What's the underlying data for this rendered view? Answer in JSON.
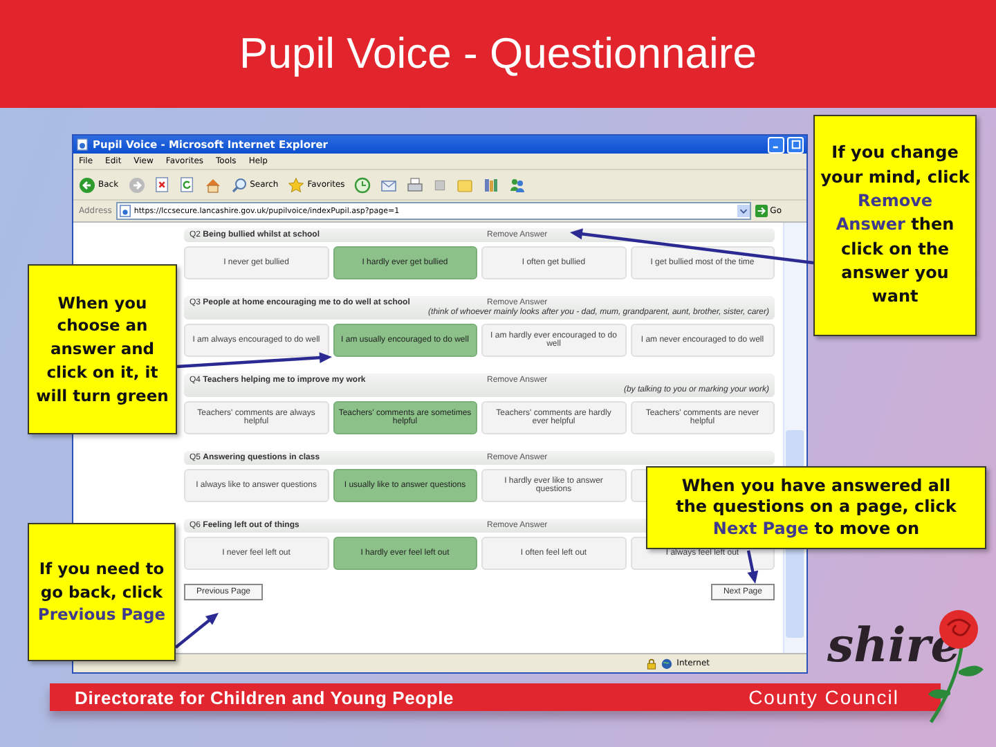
{
  "slide": {
    "title": "Pupil Voice - Questionnaire"
  },
  "browser": {
    "title": "Pupil Voice - Microsoft Internet Explorer",
    "menu": [
      "File",
      "Edit",
      "View",
      "Favorites",
      "Tools",
      "Help"
    ],
    "toolbar": [
      {
        "kind": "back",
        "label": "Back"
      },
      {
        "kind": "forward"
      },
      {
        "kind": "stop"
      },
      {
        "kind": "refresh"
      },
      {
        "kind": "home"
      },
      {
        "kind": "search",
        "label": "Search"
      },
      {
        "kind": "favorites",
        "label": "Favorites"
      },
      {
        "kind": "history"
      },
      {
        "kind": "mail"
      },
      {
        "kind": "print"
      },
      {
        "kind": "edit"
      },
      {
        "kind": "folder"
      },
      {
        "kind": "research"
      },
      {
        "kind": "messenger"
      }
    ],
    "address_label": "Address",
    "url": "https://lccsecure.lancashire.gov.uk/pupilvoice/indexPupil.asp?page=1",
    "go": "Go",
    "status": "Internet"
  },
  "questions": [
    {
      "title": "Q2 **Being bullied whilst at school**",
      "remove": "Remove Answer",
      "options": [
        {
          "text": "I never get bullied",
          "selected": false
        },
        {
          "text": "I hardly ever get bullied",
          "selected": true
        },
        {
          "text": "I often get bullied",
          "selected": false
        },
        {
          "text": "I get bullied most of the time",
          "selected": false
        }
      ]
    },
    {
      "title": "Q3 **People at home encouraging me to do well at school**",
      "remove": "Remove Answer",
      "hint": "(think of whoever mainly looks after you - dad, mum, grandparent, aunt, brother, sister, carer)",
      "options": [
        {
          "text": "I am always encouraged to do well",
          "selected": false
        },
        {
          "text": "I am usually encouraged to do well",
          "selected": true
        },
        {
          "text": "I am hardly ever encouraged to do well",
          "selected": false
        },
        {
          "text": "I am never encouraged to do well",
          "selected": false
        }
      ]
    },
    {
      "title": "Q4 **Teachers helping me to improve my work**",
      "remove": "Remove Answer",
      "hint": "(by talking to you or marking your work)",
      "options": [
        {
          "text": "Teachers' comments are always helpful",
          "selected": false
        },
        {
          "text": "Teachers' comments are sometimes helpful",
          "selected": true
        },
        {
          "text": "Teachers' comments are hardly ever helpful",
          "selected": false
        },
        {
          "text": "Teachers' comments are never helpful",
          "selected": false
        }
      ]
    },
    {
      "title": "Q5 **Answering questions in class**",
      "remove": "Remove Answer",
      "options": [
        {
          "text": "I always like to answer questions",
          "selected": false
        },
        {
          "text": "I usually like to answer questions",
          "selected": true
        },
        {
          "text": "I hardly ever like to answer questions",
          "selected": false
        },
        {
          "selected": false
        }
      ]
    },
    {
      "title": "Q6 **Feeling left out of things**",
      "remove": "Remove Answer",
      "options": [
        {
          "text": "I never feel left out",
          "selected": false
        },
        {
          "text": "I hardly ever feel left out",
          "selected": true
        },
        {
          "text": "I often feel left out",
          "selected": false
        },
        {
          "text": "I always feel left out",
          "selected": false
        }
      ]
    }
  ],
  "previous": "Previous Page",
  "next": "Next Page",
  "callouts": [
    {
      "kind": "remove",
      "parts": [
        {
          "kind": "plain",
          "text": "If you change your mind, click "
        },
        {
          "kind": "term",
          "text": "Remove Answer"
        },
        {
          "kind": "plain",
          "text": " then click on the answer you want"
        }
      ]
    },
    {
      "kind": "choose",
      "parts": [
        {
          "kind": "plain",
          "text": "When you choose an answer and click on it, it will turn green"
        }
      ]
    },
    {
      "kind": "next",
      "parts": [
        {
          "kind": "plain",
          "text": "When you have answered all the questions on a page, click "
        },
        {
          "kind": "term",
          "text": "Next Page"
        },
        {
          "kind": "plain",
          "text": " to move on"
        }
      ]
    },
    {
      "kind": "previous",
      "parts": [
        {
          "kind": "plain",
          "text": "If you need to go back, click "
        },
        {
          "kind": "term",
          "text": "Previous Page"
        }
      ]
    }
  ],
  "footer": {
    "left": "Directorate for Children and Young People",
    "right": "County Council",
    "logo": "shire"
  }
}
